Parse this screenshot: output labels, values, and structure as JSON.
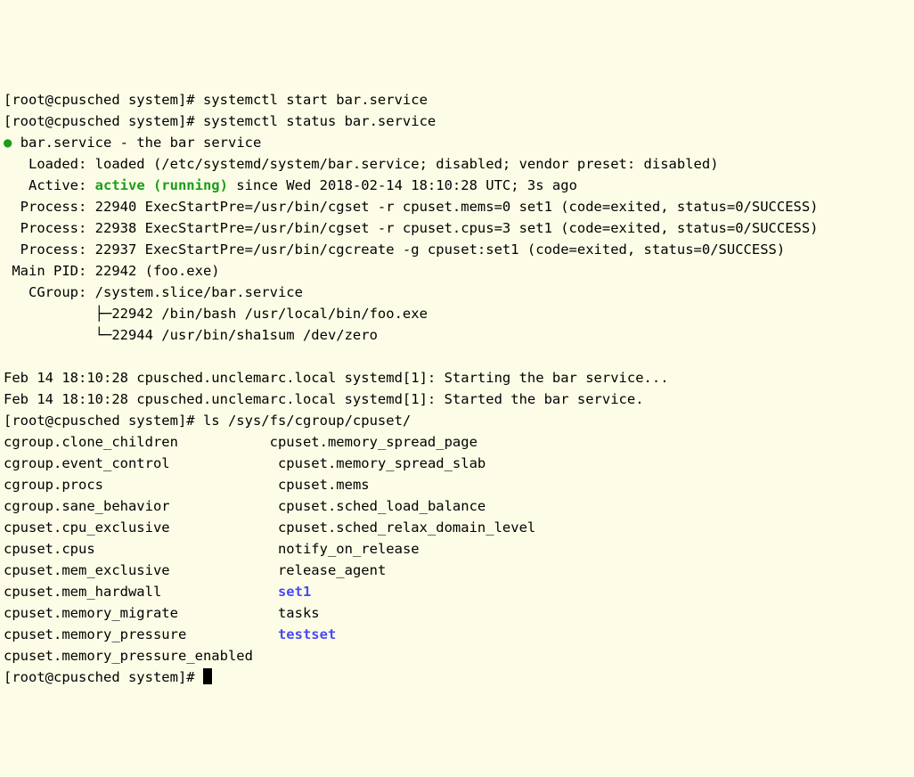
{
  "l1": "[root@cpusched system]# systemctl start bar.service",
  "l2": "[root@cpusched system]# systemctl status bar.service",
  "unit": "bar.service - the bar service",
  "loaded": "   Loaded: loaded (/etc/systemd/system/bar.service; disabled; vendor preset: disabled)",
  "active_pre": "   Active: ",
  "active_state": "active (running)",
  "active_post": " since Wed 2018-02-14 18:10:28 UTC; 3s ago",
  "p1": "  Process: 22940 ExecStartPre=/usr/bin/cgset -r cpuset.mems=0 set1 (code=exited, status=0/SUCCESS)",
  "p2": "  Process: 22938 ExecStartPre=/usr/bin/cgset -r cpuset.cpus=3 set1 (code=exited, status=0/SUCCESS)",
  "p3": "  Process: 22937 ExecStartPre=/usr/bin/cgcreate -g cpuset:set1 (code=exited, status=0/SUCCESS)",
  "mainpid": " Main PID: 22942 (foo.exe)",
  "cgroup": "   CGroup: /system.slice/bar.service",
  "tree1": "           ├─22942 /bin/bash /usr/local/bin/foo.exe",
  "tree2": "           └─22944 /usr/bin/sha1sum /dev/zero",
  "log1": "Feb 14 18:10:28 cpusched.unclemarc.local systemd[1]: Starting the bar service...",
  "log2": "Feb 14 18:10:28 cpusched.unclemarc.local systemd[1]: Started the bar service.",
  "l3": "[root@cpusched system]# ls /sys/fs/cgroup/cpuset/",
  "ls": {
    "c1r1": "cgroup.clone_children",
    "c1r2": "cgroup.event_control",
    "c1r3": "cgroup.procs",
    "c1r4": "cgroup.sane_behavior",
    "c1r5": "cpuset.cpu_exclusive",
    "c1r6": "cpuset.cpus",
    "c1r7": "cpuset.mem_exclusive",
    "c1r8": "cpuset.mem_hardwall",
    "c1r9": "cpuset.memory_migrate",
    "c1r10": "cpuset.memory_pressure",
    "c1r11": "cpuset.memory_pressure_enabled",
    "c2r1": "cpuset.memory_spread_page",
    "c2r2": "cpuset.memory_spread_slab",
    "c2r3": "cpuset.mems",
    "c2r4": "cpuset.sched_load_balance",
    "c2r5": "cpuset.sched_relax_domain_level",
    "c2r6": "notify_on_release",
    "c2r7": "release_agent",
    "c2r8": "set1",
    "c2r9": "tasks",
    "c2r10": "testset"
  },
  "prompt_last": "[root@cpusched system]# "
}
